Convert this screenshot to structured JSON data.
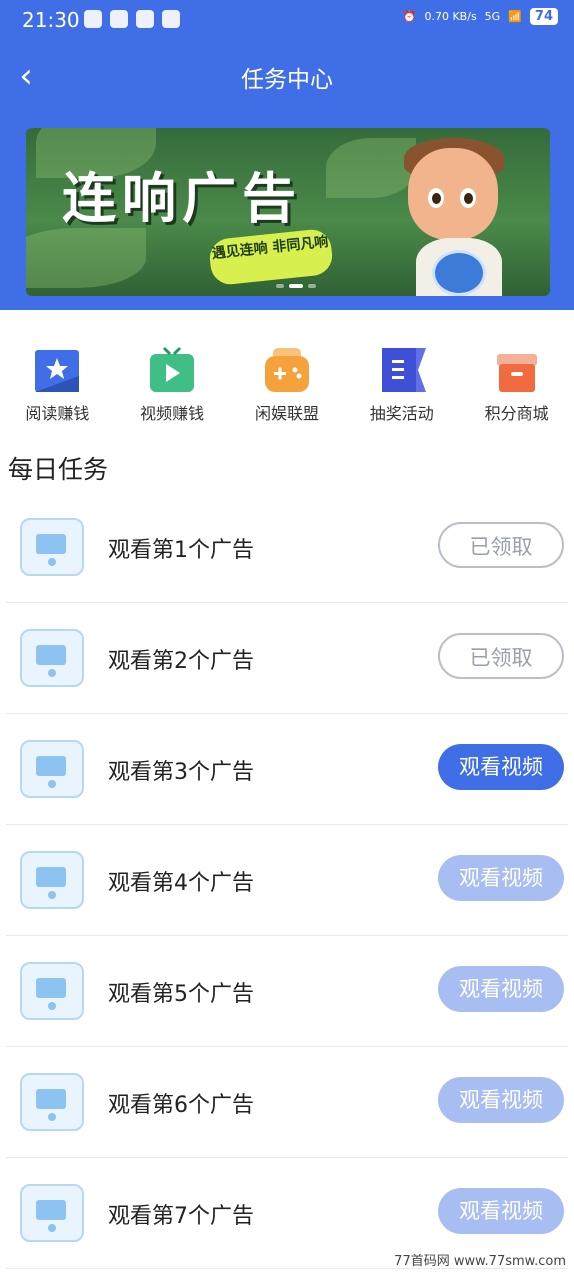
{
  "status_bar": {
    "time": "21:30",
    "speed": "0.70 KB/s",
    "network": "5G",
    "battery": "74"
  },
  "nav": {
    "title": "任务中心"
  },
  "banner": {
    "headline": "连响广告",
    "tag": "遇见连响 非同凡响"
  },
  "quick_actions": [
    {
      "label": "阅读赚钱",
      "icon": "book-star-icon",
      "color": "#3f6ee6"
    },
    {
      "label": "视频赚钱",
      "icon": "video-camera-icon",
      "color": "#3fbf86"
    },
    {
      "label": "闲娱联盟",
      "icon": "gamepad-icon",
      "color": "#f5a23c"
    },
    {
      "label": "抽奖活动",
      "icon": "flag-icon",
      "color": "#3f4fd6"
    },
    {
      "label": "积分商城",
      "icon": "gift-box-icon",
      "color": "#f26a3f"
    }
  ],
  "section": {
    "title": "每日任务"
  },
  "tasks": [
    {
      "name": "观看第1个广告",
      "button": "已领取",
      "state": "done"
    },
    {
      "name": "观看第2个广告",
      "button": "已领取",
      "state": "done"
    },
    {
      "name": "观看第3个广告",
      "button": "观看视频",
      "state": "active"
    },
    {
      "name": "观看第4个广告",
      "button": "观看视频",
      "state": "disabled"
    },
    {
      "name": "观看第5个广告",
      "button": "观看视频",
      "state": "disabled"
    },
    {
      "name": "观看第6个广告",
      "button": "观看视频",
      "state": "disabled"
    },
    {
      "name": "观看第7个广告",
      "button": "观看视频",
      "state": "disabled"
    }
  ],
  "watermark": "77首码网 www.77smw.com",
  "colors": {
    "primary": "#3f6ee6",
    "button_disabled": "#a8bdf2",
    "button_done_border": "#b9bec7"
  }
}
